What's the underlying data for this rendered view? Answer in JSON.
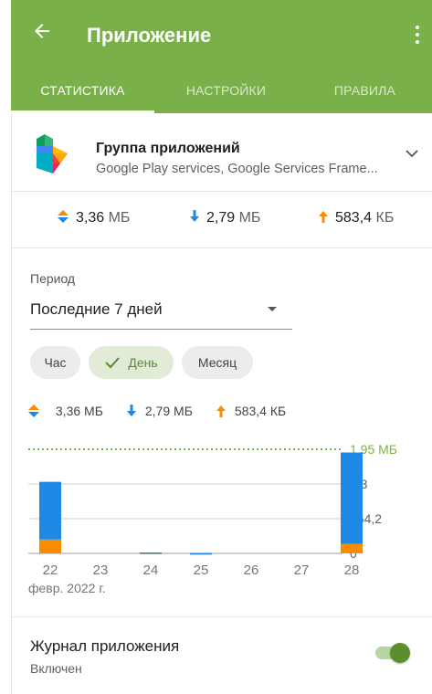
{
  "app_bar": {
    "title": "Приложение",
    "back_icon": "arrow-left-icon",
    "menu_icon": "more-vert-icon",
    "color": "#79b04a"
  },
  "tabs": [
    {
      "label": "СТАТИСТИКА",
      "active": true
    },
    {
      "label": "НАСТРОЙКИ",
      "active": false
    },
    {
      "label": "ПРАВИЛА",
      "active": false
    }
  ],
  "app_group": {
    "name": "Группа приложений",
    "subtitle": "Google Play services, Google Services Frame...",
    "icon": "google-play-services-icon",
    "expand_icon": "chevron-down-icon"
  },
  "totals": {
    "total": {
      "value": "3,36",
      "unit": "МБ",
      "icon": "up-down-arrows-icon"
    },
    "download": {
      "value": "2,79",
      "unit": "МБ",
      "icon": "arrow-down-icon",
      "color": "#1e88e5"
    },
    "upload": {
      "value": "583,4",
      "unit": "КБ",
      "icon": "arrow-up-icon",
      "color": "#fb8c00"
    }
  },
  "period": {
    "label": "Период",
    "selected": "Последние 7 дней"
  },
  "granularity_chips": [
    {
      "label": "Час",
      "selected": false
    },
    {
      "label": "День",
      "selected": true
    },
    {
      "label": "Месяц",
      "selected": false
    }
  ],
  "legend": {
    "total": "3,36 МБ",
    "download": "2,79 МБ",
    "upload": "583,4 КБ"
  },
  "chart_data": {
    "type": "bar",
    "stacked": true,
    "categories": [
      "22",
      "23",
      "24",
      "25",
      "26",
      "27",
      "28"
    ],
    "x_caption": "февр. 2022 г.",
    "y_tick_labels": [
      "0",
      "664,2",
      "1,3",
      "1,95 МБ"
    ],
    "y_max_label": "1,95 МБ",
    "y_unit": "MB",
    "ylim": [
      0,
      1.95
    ],
    "series": [
      {
        "values": [
          1.08,
          0,
          0.005,
          0.004,
          0,
          0,
          1.71
        ],
        "color": "#1e88e5"
      },
      {
        "values": [
          0.26,
          0,
          0.012,
          0.002,
          0,
          0,
          0.18
        ],
        "color": "#fb8c00"
      }
    ],
    "max_line_color": "#7cb342",
    "grid": true
  },
  "journal": {
    "title": "Журнал приложения",
    "status": "Включен",
    "enabled": true
  }
}
